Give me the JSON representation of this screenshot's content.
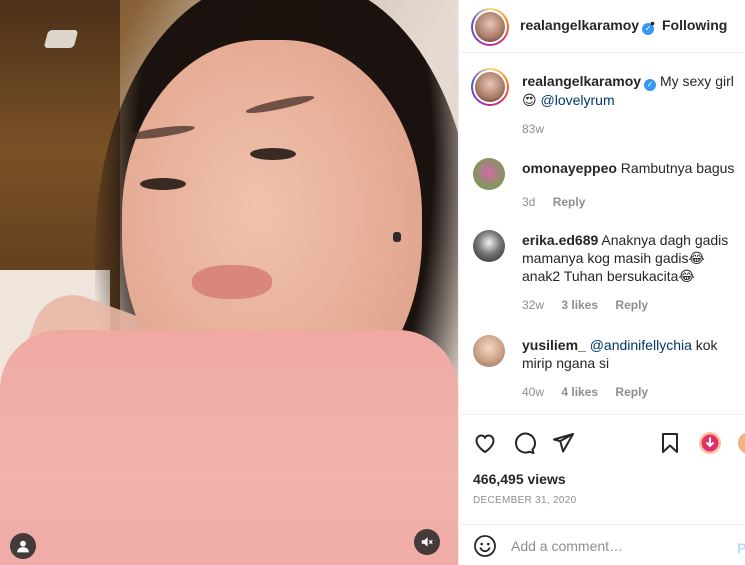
{
  "post": {
    "username": "realangelkaramoy",
    "follow_status": "Following",
    "dot": "•",
    "verified_mark": "✓"
  },
  "caption": {
    "username": "realangelkaramoy",
    "text": "My sexy girl 😍",
    "mention": "@lovelyrum",
    "time": "83w"
  },
  "comments": [
    {
      "username": "omonayeppeo",
      "mention": "",
      "text": "Rambutnya bagus",
      "time": "3d",
      "likes": "",
      "reply": "Reply"
    },
    {
      "username": "erika.ed689",
      "mention": "",
      "text": "Anaknya dagh gadis mamanya kog masih gadis😂 anak2 Tuhan bersukacita😂",
      "time": "32w",
      "likes": "3 likes",
      "reply": "Reply"
    },
    {
      "username": "yusiliem_",
      "mention": "@andinifellychia",
      "text": "kok mirip ngana si",
      "time": "40w",
      "likes": "4 likes",
      "reply": "Reply"
    }
  ],
  "stats": {
    "views": "466,495 views",
    "date": "DECEMBER 31, 2020"
  },
  "add_comment": {
    "placeholder": "Add a comment…",
    "post_label": "Post"
  },
  "icons": {
    "like": "heart-icon",
    "comment": "comment-icon",
    "share": "paper-plane-icon",
    "save": "bookmark-icon",
    "download": "download-icon",
    "emoji": "smiley-icon",
    "user": "user-icon",
    "mute": "speaker-muted-icon"
  },
  "colors": {
    "verified": "#3897f0",
    "mention": "#00376b",
    "muted_text": "#8e8e8e",
    "post_disabled": "#b2dffc"
  }
}
